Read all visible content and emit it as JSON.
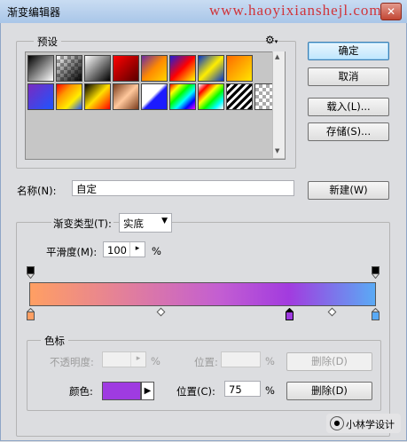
{
  "window": {
    "title": "渐变编辑器",
    "watermark": "www.haoyixianshejl.com",
    "close_glyph": "✕"
  },
  "presets": {
    "legend": "预设",
    "menu_icon": "gear-icon",
    "swatches_row1": [
      "#000000-#ffffff",
      "transparent-black",
      "#000000-#ffffff-dark",
      "#8b0000-#ff0000",
      "#6b2aa3-#ffd400",
      "#1d1dd8-#ff0000-#ffff00",
      "#0033cc-#ffee00-#0033cc",
      "#ff6a00-#ffe600"
    ],
    "swatches_row2": [
      "#5b1fa6-#1d55ff",
      "rainbow-diag",
      "#000-#ffe000-#ff0000",
      "copper",
      "#fff-#1b1bff",
      "spectrum",
      "rainbow-transparent",
      "stripes",
      "checker"
    ]
  },
  "buttons": {
    "ok": "确定",
    "cancel": "取消",
    "load": "载入(L)...",
    "save": "存储(S)...",
    "new": "新建(W)"
  },
  "name": {
    "label": "名称(N):",
    "value": "自定"
  },
  "gradient": {
    "type_label": "渐变类型(T):",
    "type_value": "实底",
    "smooth_label": "平滑度(M):",
    "smooth_value": "100",
    "smooth_unit": "%"
  },
  "color_stops": {
    "legend": "色标",
    "opacity_label": "不透明度:",
    "opacity_unit": "%",
    "opacity_location_label": "位置:",
    "opacity_location_unit": "%",
    "delete_opacity": "删除(D)",
    "color_label": "颜色:",
    "location_label": "位置(C):",
    "location_value": "75",
    "location_unit": "%",
    "delete_color": "删除(D)",
    "selected_color": "#9f3be1"
  },
  "footer": {
    "brand": "小林学设计"
  }
}
